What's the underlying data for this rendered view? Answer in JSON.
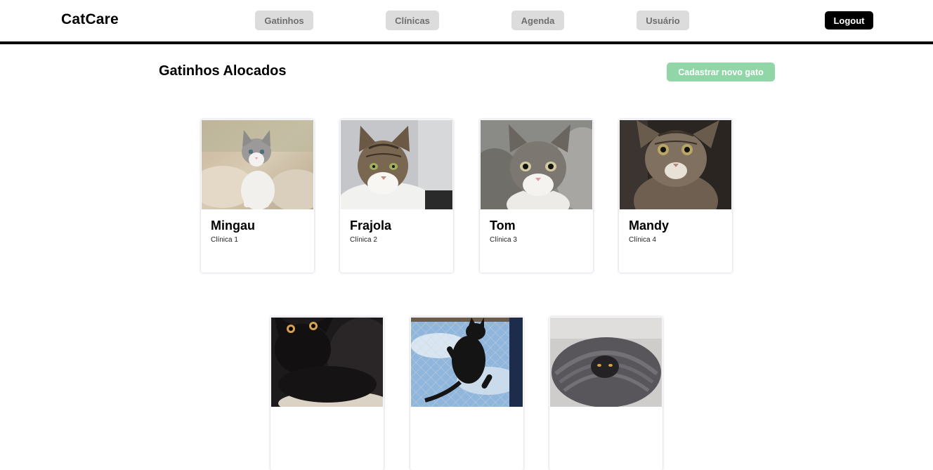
{
  "header": {
    "logo": "CatCare",
    "nav": [
      {
        "label": "Gatinhos"
      },
      {
        "label": "Clínicas"
      },
      {
        "label": "Agenda"
      },
      {
        "label": "Usuário"
      }
    ],
    "logout_label": "Logout"
  },
  "main": {
    "title": "Gatinhos Alocados",
    "add_button_label": "Cadastrar novo gato",
    "cats": [
      {
        "name": "Mingau",
        "clinic": "Clínica 1",
        "photo": "cat-photo"
      },
      {
        "name": "Frajola",
        "clinic": "Clínica 2",
        "photo": "cat-photo"
      },
      {
        "name": "Tom",
        "clinic": "Clínica 3",
        "photo": "cat-photo"
      },
      {
        "name": "Mandy",
        "clinic": "Clínica 4",
        "photo": "cat-photo"
      },
      {
        "name": "",
        "clinic": "",
        "photo": "cat-photo"
      },
      {
        "name": "",
        "clinic": "",
        "photo": "cat-photo"
      },
      {
        "name": "",
        "clinic": "",
        "photo": "cat-photo"
      }
    ]
  },
  "colors": {
    "accent_green": "#90d6a6",
    "nav_bg": "#dcdcdc",
    "logout_bg": "#000000"
  }
}
